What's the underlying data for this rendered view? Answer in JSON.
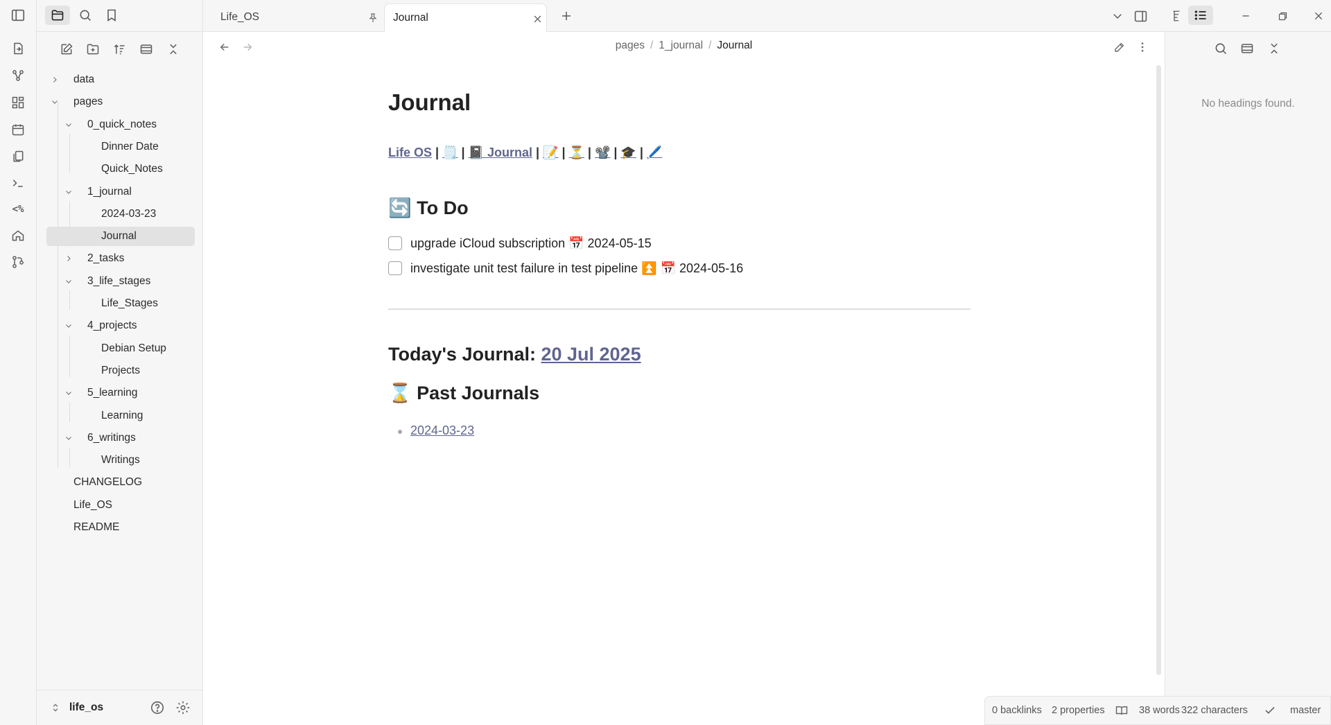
{
  "tabs": [
    {
      "label": "Life_OS",
      "pinned": true
    },
    {
      "label": "Journal",
      "active": true
    }
  ],
  "tree": {
    "data": "data",
    "pages": "pages",
    "quick_notes": "0_quick_notes",
    "dinner_date": "Dinner Date",
    "quick_notes_file": "Quick_Notes",
    "journal_folder": "1_journal",
    "journal_day": "2024-03-23",
    "journal_file": "Journal",
    "tasks": "2_tasks",
    "life_stages": "3_life_stages",
    "life_stages_file": "Life_Stages",
    "projects": "4_projects",
    "debian_setup": "Debian Setup",
    "projects_file": "Projects",
    "learning": "5_learning",
    "learning_file": "Learning",
    "writings": "6_writings",
    "writings_file": "Writings",
    "changelog": "CHANGELOG",
    "life_os": "Life_OS",
    "readme": "README"
  },
  "vault": {
    "name": "life_os"
  },
  "breadcrumb": {
    "part1": "pages",
    "part2": "1_journal",
    "current": "Journal",
    "sep": "/"
  },
  "doc": {
    "title": "Journal",
    "nav": {
      "life_os": "Life OS",
      "sep": "|",
      "e_clipboard": "🗒️",
      "journal_link": "📓 Journal",
      "e_memo": "📝",
      "e_hourglass": "⏳",
      "e_camera": "📽️",
      "e_cap": "🎓",
      "e_pen": "🖊️"
    },
    "todo_heading": "🔄 To Do",
    "tasks": [
      {
        "text": "upgrade iCloud subscription 📅 2024-05-15",
        "done": false
      },
      {
        "text": "investigate unit test failure in test pipeline ⏫ 📅 2024-05-16",
        "done": false
      }
    ],
    "today_prefix": "Today's Journal: ",
    "today_date": "20 Jul 2025",
    "past_heading": "⌛ Past Journals",
    "past_links": [
      "2024-03-23"
    ]
  },
  "status": {
    "backlinks": "0 backlinks",
    "properties": "2 properties",
    "words": "38 words",
    "characters": "322 characters",
    "branch": "master"
  },
  "outline": {
    "empty": "No headings found."
  }
}
